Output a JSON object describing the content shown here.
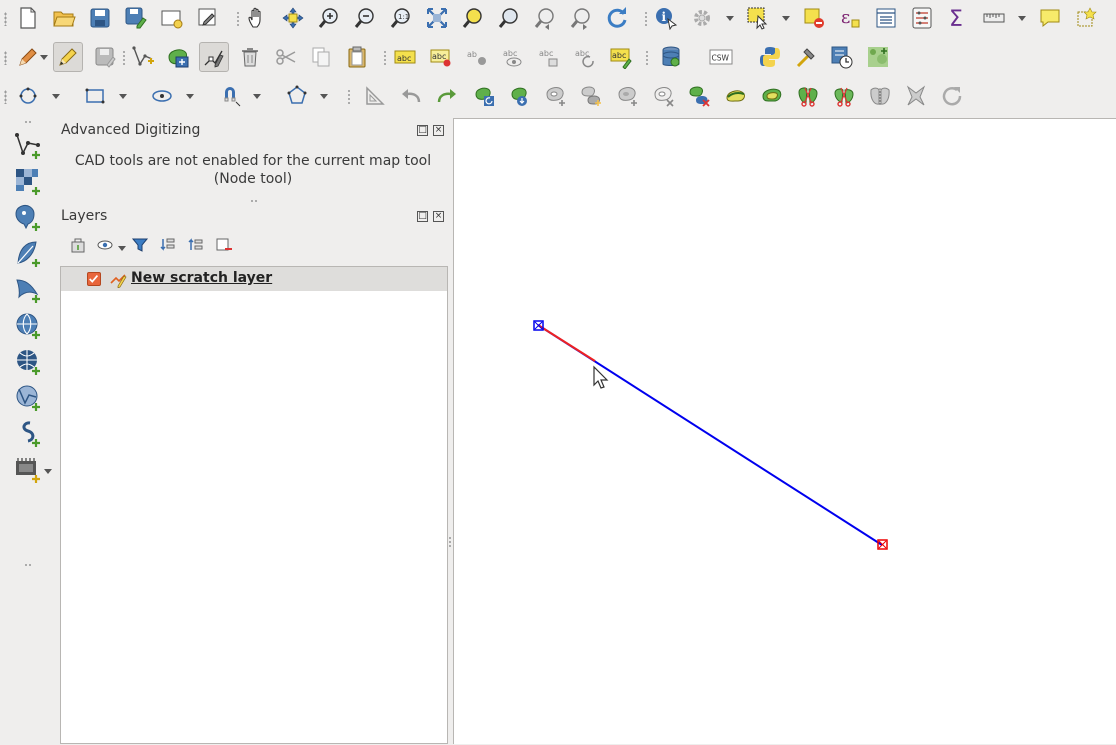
{
  "toolbars": {
    "file_and_navigation": [
      {
        "name": "new-project-icon",
        "tooltip": "New Project"
      },
      {
        "name": "open-project-icon",
        "tooltip": "Open Project"
      },
      {
        "name": "save-project-icon",
        "tooltip": "Save Project"
      },
      {
        "name": "save-project-as-icon",
        "tooltip": "Save Project As"
      },
      {
        "name": "new-print-layout-icon",
        "tooltip": "New Print Layout"
      },
      {
        "name": "layout-manager-icon",
        "tooltip": "Layout Manager"
      },
      {
        "name": "pan-map-icon",
        "tooltip": "Pan Map"
      },
      {
        "name": "pan-to-selection-icon",
        "tooltip": "Pan Map to Selection"
      },
      {
        "name": "zoom-in-icon",
        "tooltip": "Zoom In"
      },
      {
        "name": "zoom-out-icon",
        "tooltip": "Zoom Out"
      },
      {
        "name": "zoom-native-icon",
        "tooltip": "Zoom to Native Resolution"
      },
      {
        "name": "zoom-full-icon",
        "tooltip": "Zoom Full"
      },
      {
        "name": "zoom-to-selection-icon",
        "tooltip": "Zoom to Selection"
      },
      {
        "name": "zoom-to-layer-icon",
        "tooltip": "Zoom to Layer"
      },
      {
        "name": "zoom-last-icon",
        "tooltip": "Zoom Last"
      },
      {
        "name": "zoom-next-icon",
        "tooltip": "Zoom Next"
      },
      {
        "name": "refresh-icon",
        "tooltip": "Refresh"
      },
      {
        "name": "identify-features-icon",
        "tooltip": "Identify Features"
      },
      {
        "name": "run-action-icon",
        "tooltip": "Run Feature Action"
      },
      {
        "name": "select-features-icon",
        "tooltip": "Select Features"
      },
      {
        "name": "deselect-features-icon",
        "tooltip": "Deselect Features"
      },
      {
        "name": "select-by-expression-icon",
        "tooltip": "Select by Expression"
      },
      {
        "name": "attribute-table-icon",
        "tooltip": "Open Attribute Table"
      },
      {
        "name": "field-calculator-icon",
        "tooltip": "Open Field Calculator"
      },
      {
        "name": "statistical-summary-icon",
        "tooltip": "Show Statistical Summary"
      },
      {
        "name": "measure-line-icon",
        "tooltip": "Measure Line"
      },
      {
        "name": "text-annotation-icon",
        "tooltip": "Text Annotation"
      },
      {
        "name": "new-annotation-icon",
        "tooltip": "New Annotation"
      }
    ],
    "digitizing": [
      {
        "name": "current-edits-icon",
        "tooltip": "Current Edits"
      },
      {
        "name": "toggle-editing-icon",
        "tooltip": "Toggle Editing",
        "active": true
      },
      {
        "name": "save-layer-edits-icon",
        "tooltip": "Save Layer Edits"
      },
      {
        "name": "add-line-feature-icon",
        "tooltip": "Add Line Feature"
      },
      {
        "name": "move-feature-icon",
        "tooltip": "Move Feature"
      },
      {
        "name": "node-tool-icon",
        "tooltip": "Node Tool",
        "active": true
      },
      {
        "name": "delete-selected-icon",
        "tooltip": "Delete Selected"
      },
      {
        "name": "cut-features-icon",
        "tooltip": "Cut Features"
      },
      {
        "name": "copy-features-icon",
        "tooltip": "Copy Features"
      },
      {
        "name": "paste-features-icon",
        "tooltip": "Paste Features"
      },
      {
        "name": "label-tool-icon",
        "tooltip": "Layer Labeling Options"
      },
      {
        "name": "pin-labels-icon",
        "tooltip": "Pin/Unpin Labels"
      },
      {
        "name": "highlight-pinned-labels-icon",
        "tooltip": "Highlight Pinned Labels"
      },
      {
        "name": "show-hide-labels-icon",
        "tooltip": "Show/Hide Labels"
      },
      {
        "name": "move-label-icon",
        "tooltip": "Move Label"
      },
      {
        "name": "rotate-label-icon",
        "tooltip": "Rotate Label"
      },
      {
        "name": "change-label-icon",
        "tooltip": "Change Label"
      },
      {
        "name": "db-manager-icon",
        "tooltip": "DB Manager"
      },
      {
        "name": "metasearch-icon",
        "tooltip": "Metasearch",
        "text": "CSW"
      },
      {
        "name": "python-console-icon",
        "tooltip": "Python Console"
      },
      {
        "name": "processing-icon",
        "tooltip": "Processing Toolbox"
      },
      {
        "name": "temporal-icon",
        "tooltip": "Time Manager"
      },
      {
        "name": "raster-plugin-icon",
        "tooltip": "Raster Tool"
      }
    ],
    "advanced_editing": [
      {
        "name": "circle-tool-icon",
        "tooltip": "Add Circle"
      },
      {
        "name": "rectangle-tool-icon",
        "tooltip": "Add Rectangle"
      },
      {
        "name": "ellipse-tool-icon",
        "tooltip": "Add Ellipse"
      },
      {
        "name": "snapping-icon",
        "tooltip": "Snapping"
      },
      {
        "name": "polygon-tool-icon",
        "tooltip": "Add Regular Polygon"
      },
      {
        "name": "cad-tools-icon",
        "tooltip": "Enable Advanced Digitizing Tools"
      },
      {
        "name": "undo-icon",
        "tooltip": "Undo"
      },
      {
        "name": "redo-icon",
        "tooltip": "Redo"
      },
      {
        "name": "rotate-feature-icon",
        "tooltip": "Rotate Feature"
      },
      {
        "name": "simplify-feature-icon",
        "tooltip": "Simplify Feature"
      },
      {
        "name": "add-ring-icon",
        "tooltip": "Add Ring"
      },
      {
        "name": "add-part-icon",
        "tooltip": "Add Part"
      },
      {
        "name": "fill-ring-icon",
        "tooltip": "Fill Ring"
      },
      {
        "name": "delete-ring-icon",
        "tooltip": "Delete Ring"
      },
      {
        "name": "delete-part-icon",
        "tooltip": "Delete Part"
      },
      {
        "name": "reshape-features-icon",
        "tooltip": "Reshape Features"
      },
      {
        "name": "offset-curve-icon",
        "tooltip": "Offset Curve"
      },
      {
        "name": "split-features-icon",
        "tooltip": "Split Features"
      },
      {
        "name": "split-parts-icon",
        "tooltip": "Split Parts"
      },
      {
        "name": "merge-features-icon",
        "tooltip": "Merge Selected Features"
      },
      {
        "name": "merge-attributes-icon",
        "tooltip": "Merge Attributes"
      },
      {
        "name": "rotate-point-symbols-icon",
        "tooltip": "Rotate Point Symbols"
      }
    ]
  },
  "left_dock": {
    "buttons": [
      {
        "name": "add-vector-layer-icon"
      },
      {
        "name": "add-raster-layer-icon"
      },
      {
        "name": "add-postgis-layer-icon"
      },
      {
        "name": "add-spatialite-layer-icon"
      },
      {
        "name": "add-mssql-layer-icon"
      },
      {
        "name": "add-wms-layer-icon"
      },
      {
        "name": "add-wcs-layer-icon"
      },
      {
        "name": "add-wfs-layer-icon"
      },
      {
        "name": "add-delimited-text-layer-icon"
      },
      {
        "name": "add-virtual-layer-icon"
      }
    ]
  },
  "advanced_digitizing": {
    "title": "Advanced Digitizing",
    "message": "CAD tools are not enabled for the current map tool (Node tool)"
  },
  "layers_panel": {
    "title": "Layers",
    "layers": [
      {
        "name": "New scratch layer",
        "visible": true,
        "type": "line",
        "editing": true
      }
    ]
  },
  "map": {
    "colors": {
      "line": "#0000ee",
      "highlight_segment": "#ee2222",
      "start_vertex": "#0000ee",
      "end_vertex": "#ee0000",
      "canvas": "#ffffff"
    }
  }
}
